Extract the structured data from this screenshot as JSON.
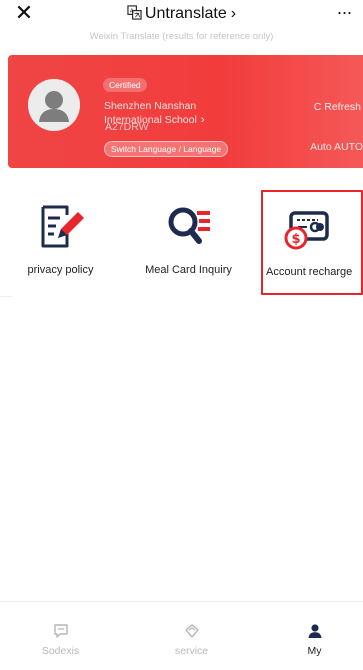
{
  "topbar": {
    "close_label": "✕",
    "title": "Untranslate",
    "title_chevron": "›",
    "more_label": "···",
    "subtitle": "Weixin Translate (results for reference only)"
  },
  "card": {
    "badge": "Certified",
    "school_line1": "Shenzhen Nanshan",
    "school_line2": "International School",
    "school_chevron": "›",
    "code": "A27DRW",
    "language_button": "Switch Language / Language",
    "refresh": "C Refresh",
    "auto": "Auto AUTO"
  },
  "grid": {
    "items": [
      {
        "label": "privacy policy",
        "icon": "document-pencil-icon"
      },
      {
        "label": "Meal Card Inquiry",
        "icon": "magnifier-list-icon"
      },
      {
        "label": "Account recharge",
        "icon": "card-dollar-icon"
      }
    ]
  },
  "bottomnav": {
    "items": [
      {
        "label": "Sodexis",
        "icon": "message-icon"
      },
      {
        "label": "service",
        "icon": "diamond-icon"
      },
      {
        "label": "My",
        "icon": "person-icon"
      }
    ]
  },
  "colors": {
    "accent_red": "#f23c3c",
    "icon_red": "#e8252b",
    "icon_navy": "#1e2b4f"
  }
}
